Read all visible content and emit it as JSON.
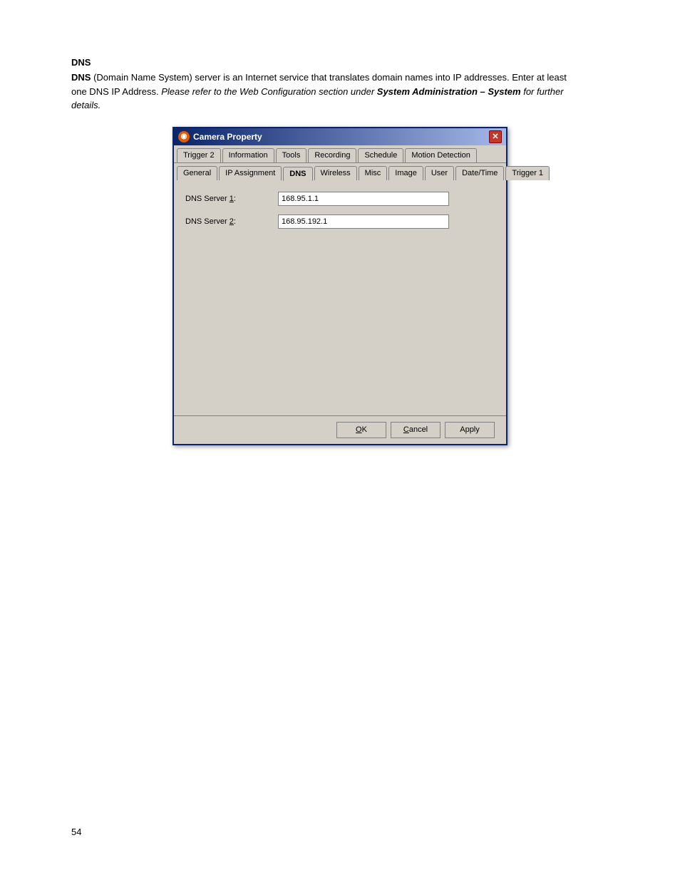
{
  "section": {
    "title": "DNS",
    "body_start": "DNS",
    "body_text": " (Domain Name System) server is an Internet service that translates domain names into IP addresses. Enter at least one DNS IP Address. ",
    "body_italic": "Please refer to the Web Configuration section under ",
    "body_bold_italic": "System Administration – System",
    "body_end": " for further details."
  },
  "dialog": {
    "title": "Camera Property",
    "close_label": "✕",
    "tabs_row1": [
      {
        "label": "Trigger 2"
      },
      {
        "label": "Information"
      },
      {
        "label": "Tools"
      },
      {
        "label": "Recording"
      },
      {
        "label": "Schedule"
      },
      {
        "label": "Motion Detection"
      }
    ],
    "tabs_row2": [
      {
        "label": "General"
      },
      {
        "label": "IP Assignment"
      },
      {
        "label": "DNS",
        "active": true
      },
      {
        "label": "Wireless"
      },
      {
        "label": "Misc"
      },
      {
        "label": "Image"
      },
      {
        "label": "User"
      },
      {
        "label": "Date/Time"
      },
      {
        "label": "Trigger 1"
      }
    ],
    "form": {
      "dns1_label": "DNS Server ",
      "dns1_label_num": "1",
      "dns1_suffix": ":",
      "dns1_value": "168.95.1.1",
      "dns2_label": "DNS Server ",
      "dns2_label_num": "2",
      "dns2_suffix": ":",
      "dns2_value": "168.95.192.1"
    },
    "footer": {
      "ok_label": "OK",
      "cancel_label": "Cancel",
      "apply_label": "Apply"
    }
  },
  "page_number": "54"
}
